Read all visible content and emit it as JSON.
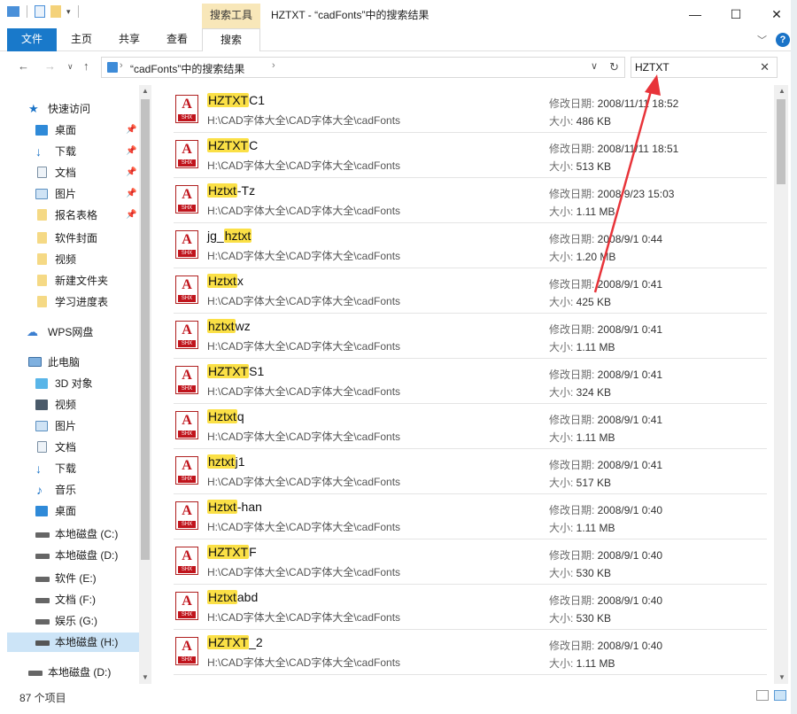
{
  "window": {
    "title": "HZTXT - “cadFonts”中的搜索结果",
    "context_tab": "搜索工具"
  },
  "ribbon": {
    "tabs": [
      "文件",
      "主页",
      "共享",
      "查看",
      "搜索"
    ]
  },
  "address": {
    "breadcrumb": "“cadFonts”中的搜索结果"
  },
  "search": {
    "value": "HZTXT"
  },
  "sidebar": {
    "quick_access": "快速访问",
    "pinned": [
      "桌面",
      "下载",
      "文档",
      "图片",
      "报名表格"
    ],
    "folders": [
      "软件封面",
      "视频",
      "新建文件夹",
      "学习进度表"
    ],
    "wps": "WPS网盘",
    "this_pc": "此电脑",
    "pc_items": [
      "3D 对象",
      "视频",
      "图片",
      "文档",
      "下载",
      "音乐",
      "桌面"
    ],
    "drives": [
      "本地磁盘 (C:)",
      "本地磁盘 (D:)",
      "软件 (E:)",
      "文档 (F:)",
      "娱乐 (G:)",
      "本地磁盘 (H:)"
    ],
    "extra_drive": "本地磁盘 (D:)"
  },
  "labels": {
    "date_prefix": "修改日期: ",
    "size_prefix": "大小: ",
    "icon_label": "SHX"
  },
  "files": [
    {
      "hl": "HZTXT",
      "rest": "C1",
      "path": "H:\\CAD字体大全\\CAD字体大全\\cadFonts",
      "date": "2008/11/11 18:52",
      "size": "486 KB"
    },
    {
      "hl": "HZTXT",
      "rest": "C",
      "path": "H:\\CAD字体大全\\CAD字体大全\\cadFonts",
      "date": "2008/11/11 18:51",
      "size": "513 KB"
    },
    {
      "hl": "Hztxt",
      "rest": "-Tz",
      "path": "H:\\CAD字体大全\\CAD字体大全\\cadFonts",
      "date": "2008/9/23 15:03",
      "size": "1.11 MB"
    },
    {
      "pre": "jg_",
      "hl": "hztxt",
      "rest": "",
      "path": "H:\\CAD字体大全\\CAD字体大全\\cadFonts",
      "date": "2008/9/1 0:44",
      "size": "1.20 MB"
    },
    {
      "hl": "Hztxt",
      "rest": "x",
      "path": "H:\\CAD字体大全\\CAD字体大全\\cadFonts",
      "date": "2008/9/1 0:41",
      "size": "425 KB"
    },
    {
      "hl": "hztxt",
      "rest": "wz",
      "path": "H:\\CAD字体大全\\CAD字体大全\\cadFonts",
      "date": "2008/9/1 0:41",
      "size": "1.11 MB"
    },
    {
      "hl": "HZTXT",
      "rest": "S1",
      "path": "H:\\CAD字体大全\\CAD字体大全\\cadFonts",
      "date": "2008/9/1 0:41",
      "size": "324 KB"
    },
    {
      "hl": "Hztxt",
      "rest": "q",
      "path": "H:\\CAD字体大全\\CAD字体大全\\cadFonts",
      "date": "2008/9/1 0:41",
      "size": "1.11 MB"
    },
    {
      "hl": "hztxt",
      "rest": "j1",
      "path": "H:\\CAD字体大全\\CAD字体大全\\cadFonts",
      "date": "2008/9/1 0:41",
      "size": "517 KB"
    },
    {
      "hl": "Hztxt",
      "rest": "-han",
      "path": "H:\\CAD字体大全\\CAD字体大全\\cadFonts",
      "date": "2008/9/1 0:40",
      "size": "1.11 MB"
    },
    {
      "hl": "HZTXT",
      "rest": "F",
      "path": "H:\\CAD字体大全\\CAD字体大全\\cadFonts",
      "date": "2008/9/1 0:40",
      "size": "530 KB"
    },
    {
      "hl": "Hztxt",
      "rest": "abd",
      "path": "H:\\CAD字体大全\\CAD字体大全\\cadFonts",
      "date": "2008/9/1 0:40",
      "size": "530 KB"
    },
    {
      "hl": "HZTXT",
      "rest": "_2",
      "path": "H:\\CAD字体大全\\CAD字体大全\\cadFonts",
      "date": "2008/9/1 0:40",
      "size": "1.11 MB"
    }
  ],
  "status": {
    "count": "87 个项目"
  },
  "colors": {
    "accent": "#1979ca",
    "highlight": "#fbe046",
    "context_tab": "#f8e7b9",
    "annotation_arrow": "#e8343a"
  }
}
